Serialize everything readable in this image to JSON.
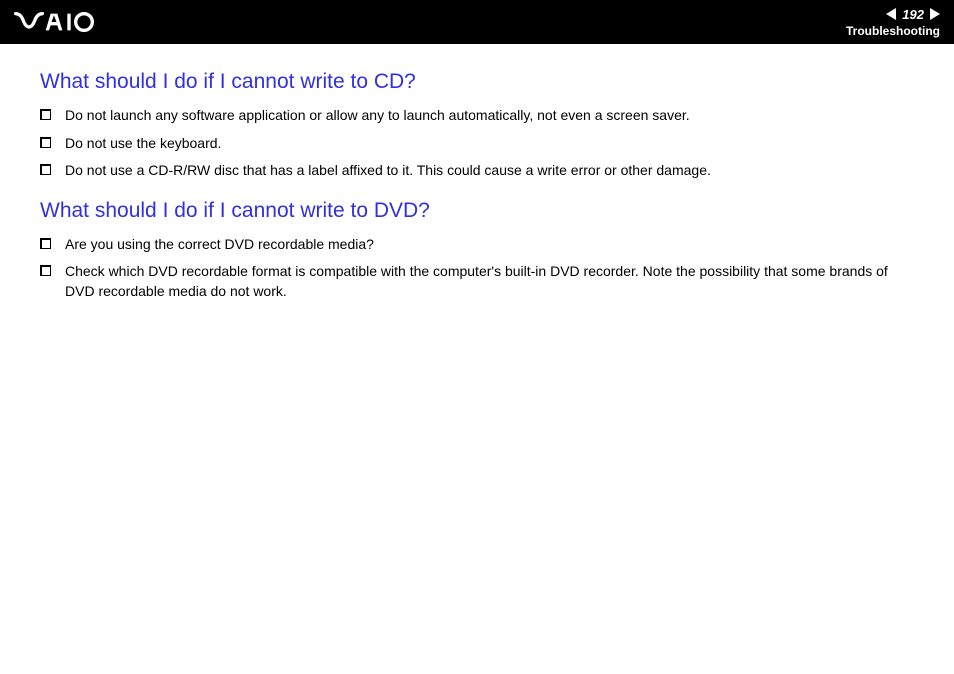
{
  "header": {
    "page_number": "192",
    "section": "Troubleshooting"
  },
  "content": {
    "sections": [
      {
        "heading": "What should I do if I cannot write to CD?",
        "items": [
          "Do not launch any software application or allow any to launch automatically, not even a screen saver.",
          "Do not use the keyboard.",
          "Do not use a CD-R/RW disc that has a label affixed to it. This could cause a write error or other damage."
        ]
      },
      {
        "heading": "What should I do if I cannot write to DVD?",
        "items": [
          "Are you using the correct DVD recordable media?",
          "Check which DVD recordable format is compatible with the computer's built-in DVD recorder. Note the possibility that some brands of DVD recordable media do not work."
        ]
      }
    ]
  }
}
